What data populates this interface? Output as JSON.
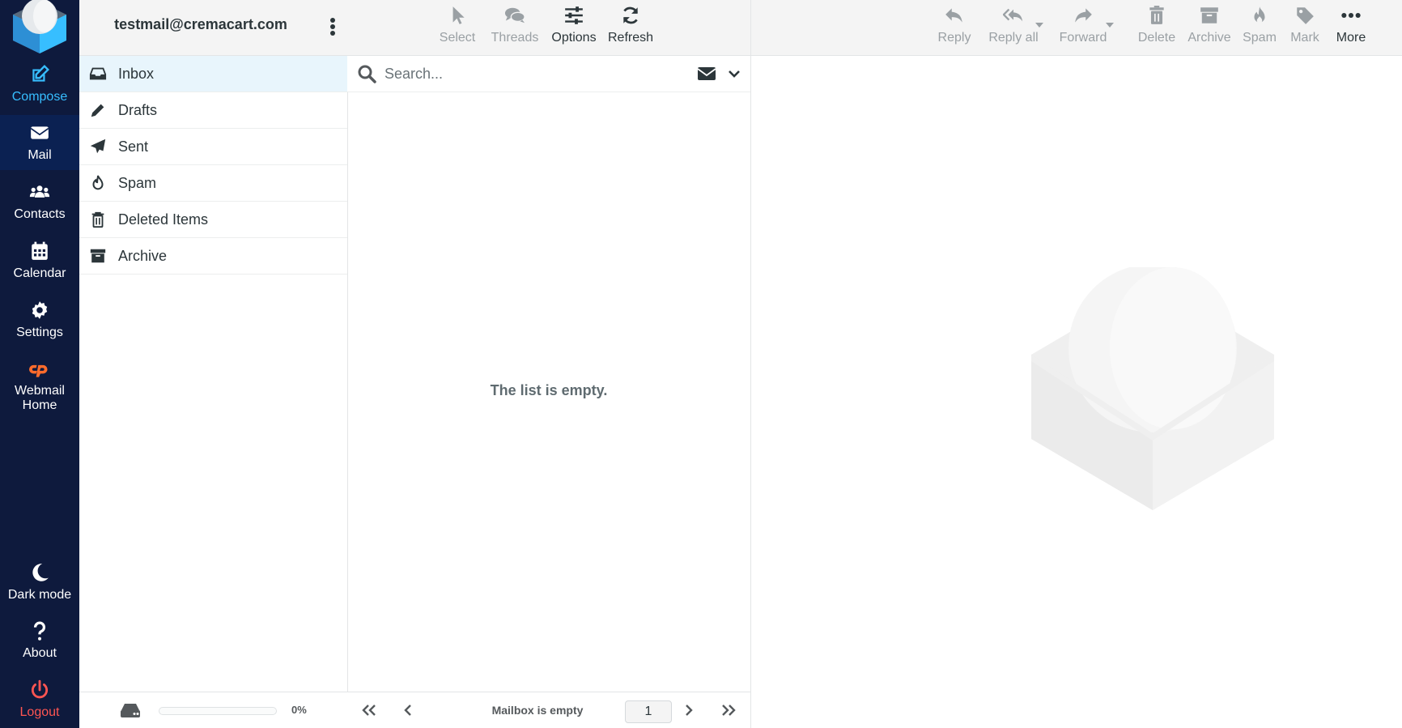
{
  "nav": {
    "compose": "Compose",
    "mail": "Mail",
    "contacts": "Contacts",
    "calendar": "Calendar",
    "settings": "Settings",
    "webmail_home": "Webmail Home",
    "dark_mode": "Dark mode",
    "about": "About",
    "logout": "Logout"
  },
  "account": {
    "email": "testmail@cremacart.com"
  },
  "folders": [
    {
      "label": "Inbox",
      "icon": "inbox-icon",
      "selected": true
    },
    {
      "label": "Drafts",
      "icon": "pencil-icon"
    },
    {
      "label": "Sent",
      "icon": "paper-plane-icon"
    },
    {
      "label": "Spam",
      "icon": "fire-icon"
    },
    {
      "label": "Deleted Items",
      "icon": "trash-icon"
    },
    {
      "label": "Archive",
      "icon": "archive-box-icon"
    }
  ],
  "quota": {
    "text": "0%",
    "fraction": 0
  },
  "list_toolbar": {
    "select": "Select",
    "threads": "Threads",
    "options": "Options",
    "refresh": "Refresh"
  },
  "search": {
    "placeholder": "Search..."
  },
  "list": {
    "empty_message": "The list is empty."
  },
  "pager": {
    "status": "Mailbox is empty",
    "page": "1"
  },
  "message_toolbar": {
    "reply": "Reply",
    "reply_all": "Reply all",
    "forward": "Forward",
    "delete": "Delete",
    "archive": "Archive",
    "spam": "Spam",
    "mark": "Mark",
    "more": "More"
  },
  "colors": {
    "nav_bg": "#0e1a3d",
    "nav_active_bg": "#0b2152",
    "accent": "#37beff",
    "logout_red": "#ff5552",
    "cpanel_orange": "#ff6c2c",
    "toolbar_bg": "#f4f4f4",
    "selected_folder_bg": "#e8f5fc"
  }
}
